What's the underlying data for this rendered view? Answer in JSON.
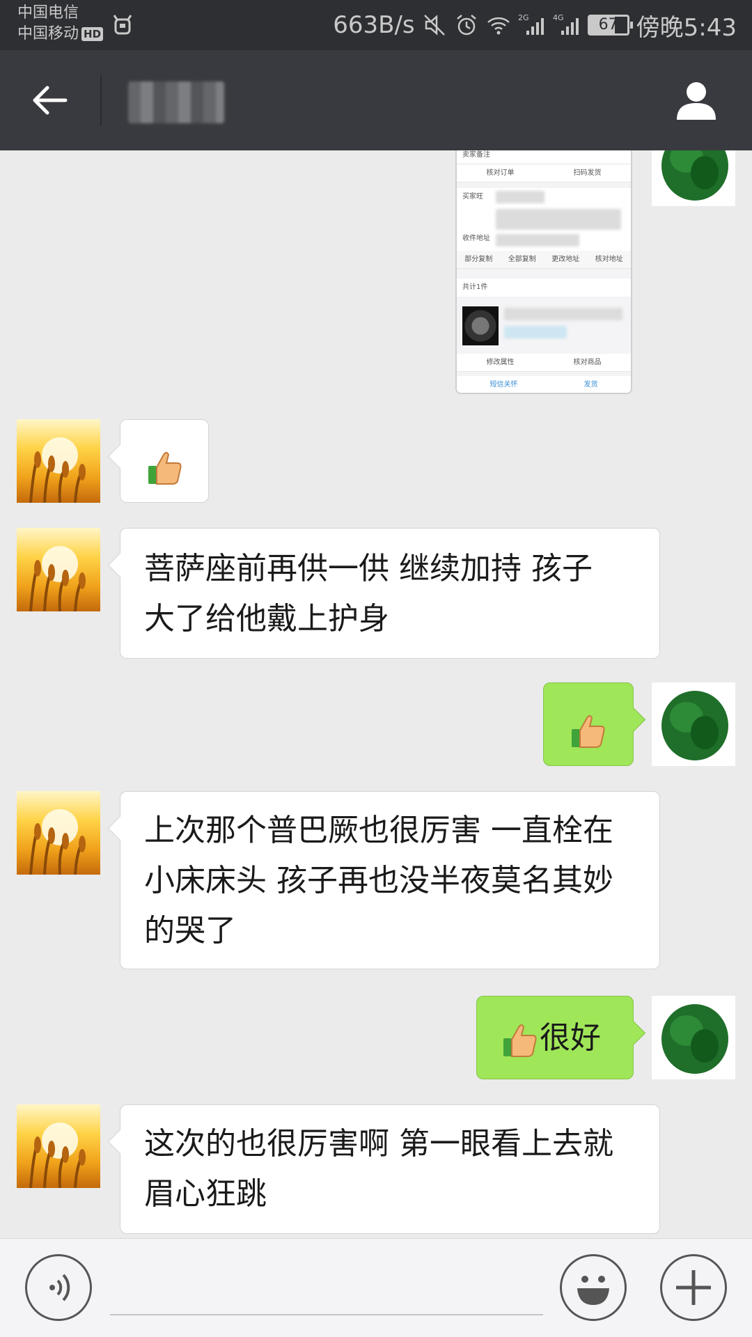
{
  "status_bar": {
    "carrier_1": "中国电信",
    "carrier_2": "中国移动",
    "hd_badge": "HD",
    "network_speed": "663B/s",
    "signal_1_label": "2G",
    "signal_2_label": "4G",
    "battery_level": "67",
    "time": "傍晚5:43",
    "icons": [
      "mute-icon",
      "alarm-icon",
      "wifi-icon",
      "signal-2g-icon",
      "signal-4g-icon",
      "battery-icon"
    ]
  },
  "header": {
    "back_icon": "arrow-left-icon",
    "contact_name_visible": false,
    "profile_icon": "person-icon"
  },
  "image_message": {
    "rows": [
      "卖家备注",
      "核对订单",
      "扫码发货",
      "买家旺",
      "收件地址",
      "部分复制",
      "全部复制",
      "更改地址",
      "核对地址",
      "共计1件",
      "修改属性",
      "核对商品",
      "短信关怀",
      "发货"
    ]
  },
  "messages": [
    {
      "sender": "contact",
      "type": "emoji",
      "emoji": "thumbs-up"
    },
    {
      "sender": "contact",
      "type": "text",
      "lines": [
        "菩萨座前再供一供 继续加持  孩子",
        "大了给他戴上护身"
      ]
    },
    {
      "sender": "me",
      "type": "emoji",
      "emoji": "thumbs-up"
    },
    {
      "sender": "contact",
      "type": "text",
      "lines": [
        "上次那个普巴厥也很厉害 一直栓在",
        "小床床头 孩子再也没半夜莫名其妙",
        "的哭了"
      ]
    },
    {
      "sender": "me",
      "type": "text",
      "emoji": "thumbs-up",
      "text": "很好"
    },
    {
      "sender": "contact",
      "type": "text",
      "lines": [
        "这次的也很厉害啊 第一眼看上去就",
        "眉心狂跳"
      ]
    }
  ],
  "input_bar": {
    "voice_icon": "voice-icon",
    "emoji_icon": "smiley-icon",
    "plus_icon": "plus-icon",
    "input_value": ""
  },
  "colors": {
    "status_bar_bg": "#2e2f33",
    "title_bar_bg": "#393a3f",
    "chat_bg": "#ebebeb",
    "outgoing_bubble": "#9fe658",
    "incoming_bubble": "#ffffff"
  }
}
